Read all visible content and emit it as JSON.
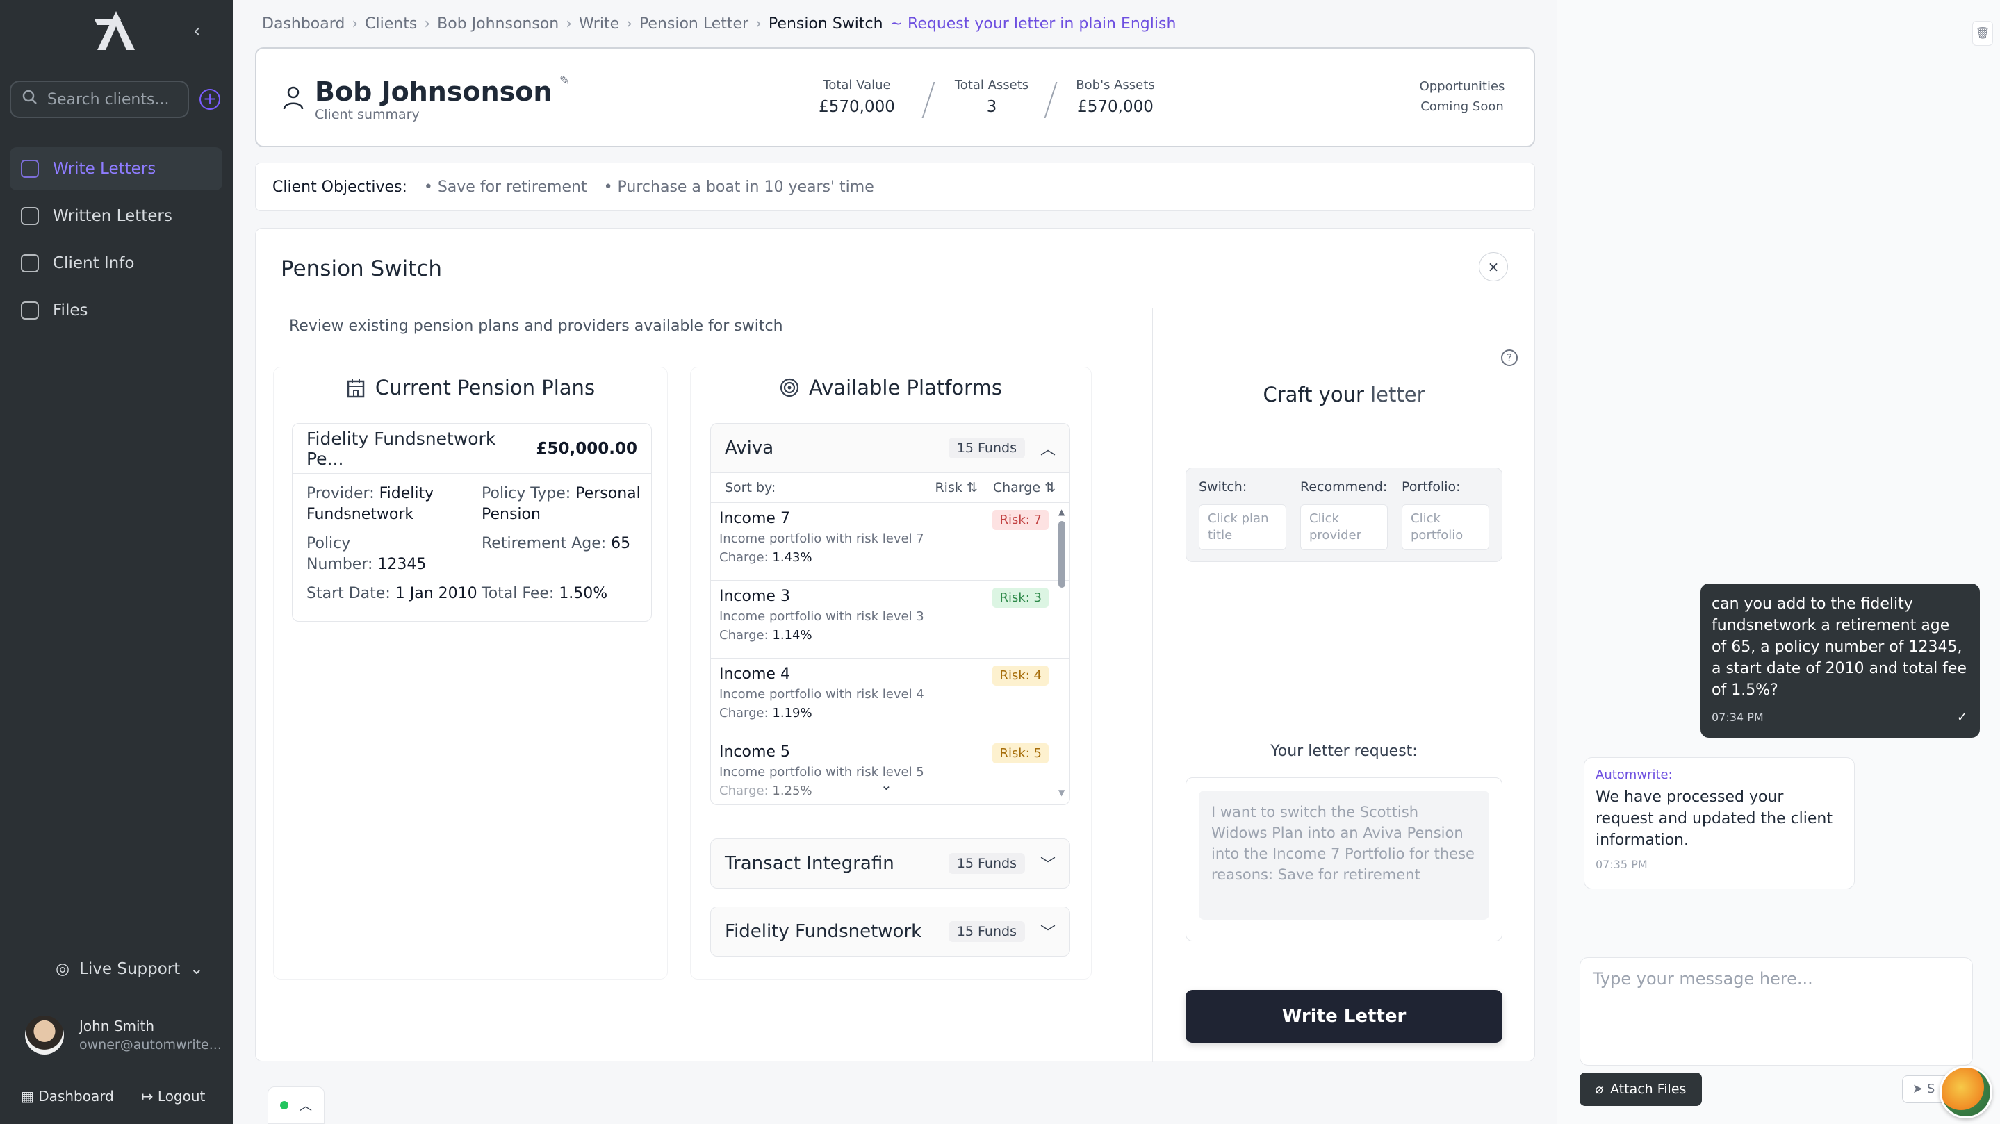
{
  "sidebar": {
    "search_placeholder": "Search clients...",
    "items": [
      {
        "label": "Write Letters",
        "active": true
      },
      {
        "label": "Written Letters"
      },
      {
        "label": "Client Info"
      },
      {
        "label": "Files"
      }
    ],
    "support_label": "Live Support",
    "user": {
      "name": "John Smith",
      "email": "owner@automwrite..."
    },
    "dashboard_label": "Dashboard",
    "logout_label": "Logout"
  },
  "breadcrumb": {
    "items": [
      "Dashboard",
      "Clients",
      "Bob Johnsonson",
      "Write",
      "Pension Letter"
    ],
    "current": "Pension Switch",
    "request_link": "~ Request your letter in plain English"
  },
  "client": {
    "name": "Bob Johnsonson",
    "subtitle": "Client summary",
    "stats": [
      {
        "label": "Total Value",
        "value": "£570,000"
      },
      {
        "label": "Total Assets",
        "value": "3"
      },
      {
        "label": "Bob's Assets",
        "value": "£570,000"
      }
    ],
    "opportunities": {
      "label": "Opportunities",
      "value": "Coming Soon"
    }
  },
  "objectives": {
    "label": "Client Objectives:",
    "items": [
      "• Save for retirement",
      "• Purchase a boat in 10 years' time"
    ]
  },
  "panel": {
    "title": "Pension Switch",
    "close_label": "×",
    "description": "Review existing pension plans and providers available for switch"
  },
  "current_plans": {
    "title": "Current Pension Plans",
    "plan": {
      "name": "Fidelity Fundsnetwork Pe...",
      "amount": "£50,000.00",
      "provider_label": "Provider:",
      "provider_value_1": "Fidelity",
      "provider_value_2": "Fundsnetwork",
      "type_label": "Policy Type:",
      "type_value_1": "Personal",
      "type_value_2": "Pension",
      "policy_label_1": "Policy",
      "policy_label_2": "Number:",
      "policy_value": "12345",
      "retirement_label": "Retirement Age:",
      "retirement_value": "65",
      "start_label": "Start Date:",
      "start_value": "1 Jan 2010",
      "fee_label": "Total Fee:",
      "fee_value": "1.50%"
    }
  },
  "platforms": {
    "title": "Available Platforms",
    "sort_label": "Sort by:",
    "sort_risk": "Risk",
    "sort_charge": "Charge",
    "providers": [
      {
        "name": "Aviva",
        "funds": "15 Funds"
      },
      {
        "name": "Transact Integrafin",
        "funds": "15 Funds"
      },
      {
        "name": "Fidelity Fundsnetwork",
        "funds": "15 Funds"
      }
    ],
    "funds": [
      {
        "name": "Income 7",
        "desc": "Income portfolio with risk level 7",
        "charge_label": "Charge:",
        "charge": "1.43%",
        "risk": "Risk: 7",
        "risk_color": "#fde2e2",
        "risk_text": "#c24141"
      },
      {
        "name": "Income 3",
        "desc": "Income portfolio with risk level 3",
        "charge_label": "Charge:",
        "charge": "1.14%",
        "risk": "Risk: 3",
        "risk_color": "#dcf5e3",
        "risk_text": "#2f8a4a"
      },
      {
        "name": "Income 4",
        "desc": "Income portfolio with risk level 4",
        "charge_label": "Charge:",
        "charge": "1.19%",
        "risk": "Risk: 4",
        "risk_color": "#fdf1cf",
        "risk_text": "#a66d0a"
      },
      {
        "name": "Income 5",
        "desc": "Income portfolio with risk level 5",
        "charge_label": "Charge:",
        "charge": "1.25%",
        "risk": "Risk: 5",
        "risk_color": "#fdf1cf",
        "risk_text": "#a66d0a"
      }
    ]
  },
  "craft": {
    "title_a": "Craft your",
    "title_b": "letter",
    "switch_label": "Switch:",
    "switch_placeholder": "Click plan title",
    "recommend_label": "Recommend:",
    "recommend_placeholder": "Click provider",
    "portfolio_label": "Portfolio:",
    "portfolio_placeholder": "Click portfolio",
    "request_label": "Your letter request:",
    "request_text": "I want to switch the Scottish Widows Plan into an Aviva Pension into the Income 7 Portfolio for these reasons: Save for retirement",
    "write_button": "Write Letter"
  },
  "chat": {
    "user_message": "can you add to the fidelity fundsnetwork a retirement age of 65, a policy number of 12345, a start date of 2010 and total fee of 1.5%?",
    "user_time": "07:34 PM",
    "bot_name": "Automwrite:",
    "bot_message": "We have processed your request and updated the client information.",
    "bot_time": "07:35 PM",
    "input_placeholder": "Type your message here...",
    "attach_label": "Attach Files",
    "send_label": "S"
  },
  "colors": {
    "accent": "#6d4fe0",
    "sidebar_bg": "#2b3034",
    "button_dark": "#1f2433"
  }
}
